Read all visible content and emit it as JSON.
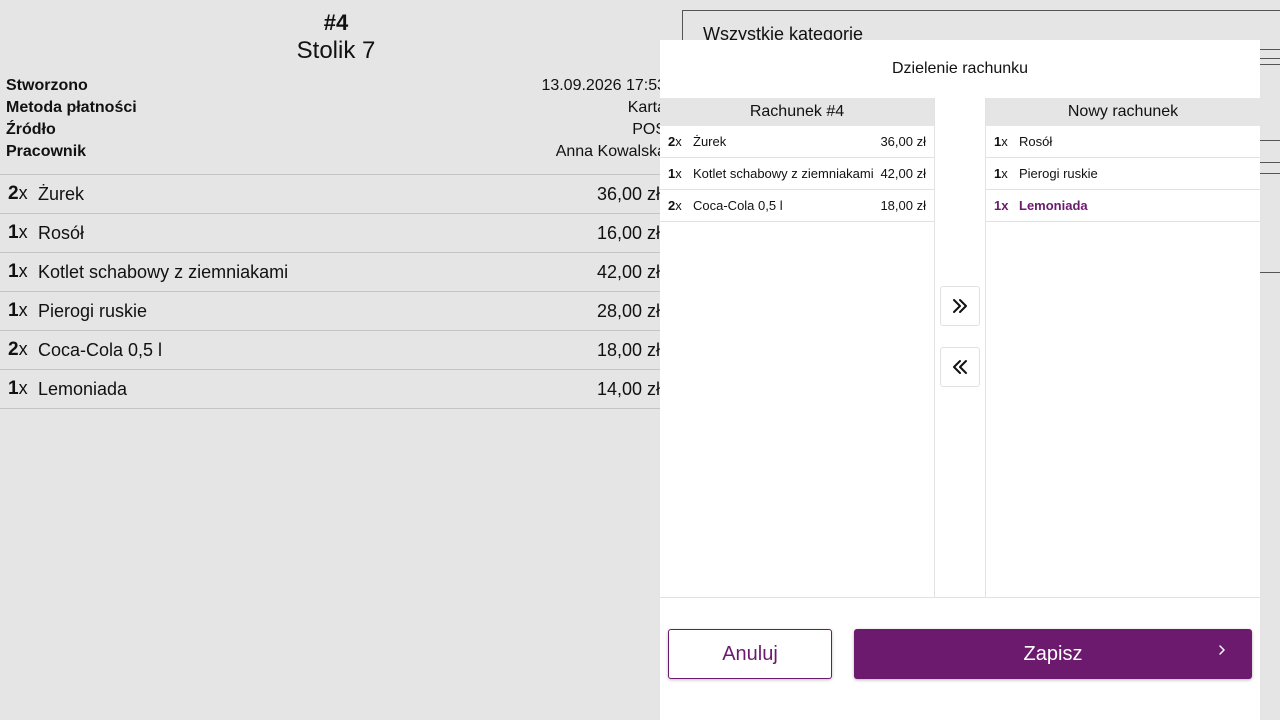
{
  "order": {
    "number": "#4",
    "table": "Stolik 7",
    "meta": [
      {
        "label": "Stworzono",
        "value": "13.09.2026 17:53"
      },
      {
        "label": "Metoda płatności",
        "value": "Karta"
      },
      {
        "label": "Źródło",
        "value": "POS"
      },
      {
        "label": "Pracownik",
        "value": "Anna Kowalska"
      }
    ],
    "items": [
      {
        "qty": "2",
        "unit": "x",
        "name": "Żurek",
        "price": "36,00 zł"
      },
      {
        "qty": "1",
        "unit": "x",
        "name": "Rosół",
        "price": "16,00 zł"
      },
      {
        "qty": "1",
        "unit": "x",
        "name": "Kotlet schabowy z ziemniakami",
        "price": "42,00 zł"
      },
      {
        "qty": "1",
        "unit": "x",
        "name": "Pierogi ruskie",
        "price": "28,00 zł"
      },
      {
        "qty": "2",
        "unit": "x",
        "name": "Coca-Cola 0,5 l",
        "price": "18,00 zł"
      },
      {
        "qty": "1",
        "unit": "x",
        "name": "Lemoniada",
        "price": "14,00 zł"
      }
    ]
  },
  "category_filter": {
    "label": "Wszystkie kategorie"
  },
  "split_dialog": {
    "title": "Dzielenie rachunku",
    "left_bill": {
      "title": "Rachunek #4",
      "items": [
        {
          "qty": "2",
          "unit": "x",
          "name": "Żurek",
          "price": "36,00 zł"
        },
        {
          "qty": "1",
          "unit": "x",
          "name": "Kotlet schabowy z ziemniakami",
          "price": "42,00 zł"
        },
        {
          "qty": "2",
          "unit": "x",
          "name": "Coca-Cola 0,5 l",
          "price": "18,00 zł"
        }
      ]
    },
    "right_bill": {
      "title": "Nowy rachunek",
      "items": [
        {
          "qty": "1",
          "unit": "x",
          "name": "Rosół"
        },
        {
          "qty": "1",
          "unit": "x",
          "name": "Pierogi ruskie"
        },
        {
          "qty": "1",
          "unit": "x",
          "name": "Lemoniada",
          "selected": true
        }
      ]
    },
    "move_right_icon": "double-chevron-right-icon",
    "move_left_icon": "double-chevron-left-icon",
    "cancel_label": "Anuluj",
    "save_label": "Zapisz",
    "save_icon": "chevron-right-icon",
    "accent_color": "#6b1a6e"
  }
}
